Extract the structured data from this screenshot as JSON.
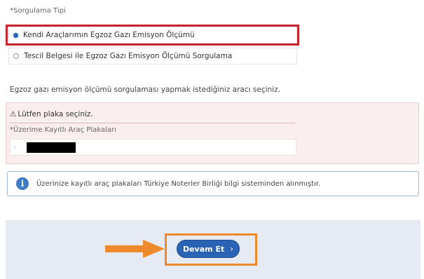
{
  "query_type_label": "*Sorgulama Tipi",
  "options": [
    {
      "label": "Kendi Araçlarımın Egzoz Gazı Emisyon Ölçümü",
      "selected": true
    },
    {
      "label": "Tescil Belgesi ile Egzoz Gazı Emisyon Ölçümü Sorgulama",
      "selected": false
    }
  ],
  "instruction": "Egzoz gazı emisyon ölçümü sorgulaması yapmak istediğiniz aracı seçiniz.",
  "warning": {
    "icon": "⚠",
    "text": "Lütfen plaka seçiniz."
  },
  "plates_label": "*Üzerime Kayıtlı Araç Plakaları",
  "info": {
    "icon": "i",
    "text": "Üzerinize kayıtlı araç plakaları Türkiye Noterler Birliği bilgi sisteminden alınmıştır."
  },
  "next_button": {
    "label": "Devam Et",
    "icon": "›"
  },
  "colors": {
    "highlight_red": "#c8252f",
    "highlight_orange": "#ef8a2c",
    "button_blue": "#2a63b3"
  }
}
